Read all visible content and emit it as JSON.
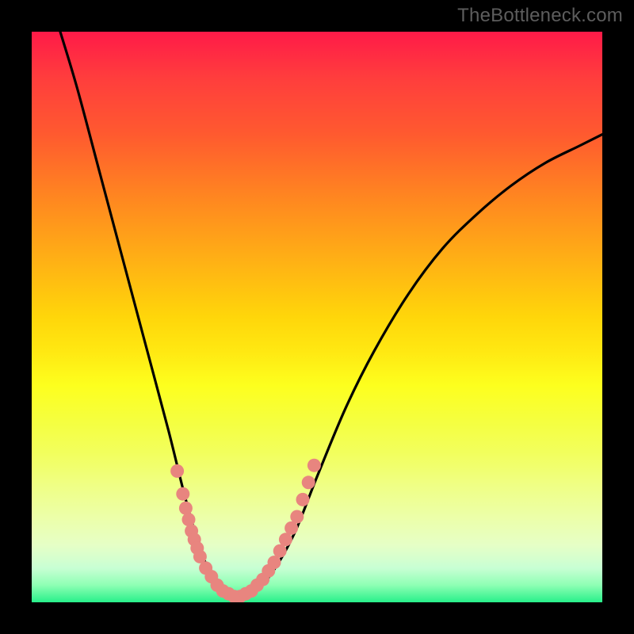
{
  "attribution": "TheBottleneck.com",
  "chart_data": {
    "type": "line",
    "title": "",
    "xlabel": "",
    "ylabel": "",
    "xlim": [
      0,
      100
    ],
    "ylim": [
      0,
      100
    ],
    "grid": false,
    "legend": false,
    "series": [
      {
        "name": "curve",
        "color": "#000000",
        "points": [
          {
            "x": 5,
            "y": 100
          },
          {
            "x": 8,
            "y": 90
          },
          {
            "x": 12,
            "y": 75
          },
          {
            "x": 16,
            "y": 60
          },
          {
            "x": 20,
            "y": 45
          },
          {
            "x": 24,
            "y": 30
          },
          {
            "x": 27,
            "y": 18
          },
          {
            "x": 30,
            "y": 8
          },
          {
            "x": 33,
            "y": 3
          },
          {
            "x": 36,
            "y": 1
          },
          {
            "x": 39,
            "y": 2
          },
          {
            "x": 42,
            "y": 5
          },
          {
            "x": 46,
            "y": 12
          },
          {
            "x": 50,
            "y": 22
          },
          {
            "x": 55,
            "y": 34
          },
          {
            "x": 60,
            "y": 44
          },
          {
            "x": 66,
            "y": 54
          },
          {
            "x": 72,
            "y": 62
          },
          {
            "x": 78,
            "y": 68
          },
          {
            "x": 84,
            "y": 73
          },
          {
            "x": 90,
            "y": 77
          },
          {
            "x": 96,
            "y": 80
          },
          {
            "x": 100,
            "y": 82
          }
        ]
      },
      {
        "name": "markers",
        "color": "#e8857f",
        "points": [
          {
            "x": 25.5,
            "y": 23
          },
          {
            "x": 26.5,
            "y": 19
          },
          {
            "x": 27.0,
            "y": 16.5
          },
          {
            "x": 27.5,
            "y": 14.5
          },
          {
            "x": 28.0,
            "y": 12.5
          },
          {
            "x": 28.5,
            "y": 11
          },
          {
            "x": 29.0,
            "y": 9.5
          },
          {
            "x": 29.5,
            "y": 8
          },
          {
            "x": 30.5,
            "y": 6
          },
          {
            "x": 31.5,
            "y": 4.5
          },
          {
            "x": 32.5,
            "y": 3
          },
          {
            "x": 33.5,
            "y": 2
          },
          {
            "x": 34.5,
            "y": 1.5
          },
          {
            "x": 35.5,
            "y": 1
          },
          {
            "x": 36.5,
            "y": 1
          },
          {
            "x": 37.5,
            "y": 1.5
          },
          {
            "x": 38.5,
            "y": 2
          },
          {
            "x": 39.5,
            "y": 3
          },
          {
            "x": 40.5,
            "y": 4
          },
          {
            "x": 41.5,
            "y": 5.5
          },
          {
            "x": 42.5,
            "y": 7
          },
          {
            "x": 43.5,
            "y": 9
          },
          {
            "x": 44.5,
            "y": 11
          },
          {
            "x": 45.5,
            "y": 13
          },
          {
            "x": 46.5,
            "y": 15
          },
          {
            "x": 47.5,
            "y": 18
          },
          {
            "x": 48.5,
            "y": 21
          },
          {
            "x": 49.5,
            "y": 24
          }
        ]
      }
    ]
  }
}
